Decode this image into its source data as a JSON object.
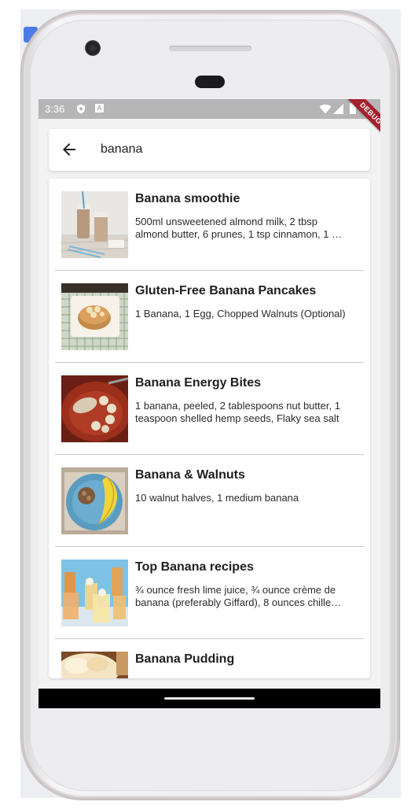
{
  "status_bar": {
    "time": "3:36",
    "shield_icon": "shield-icon",
    "notification_icon": "a-notification-icon",
    "wifi_icon": "wifi-icon",
    "signal_icon": "signal-icon",
    "battery_icon": "battery-icon"
  },
  "debug_banner": {
    "label": "DEBUG",
    "color": "#a3222d"
  },
  "search": {
    "back_icon": "arrow-back-icon",
    "query": "banana"
  },
  "results": [
    {
      "title": "Banana smoothie",
      "description": "500ml unsweetened almond milk, 2 tbsp almond butter, 6 prunes, 1 tsp cinnamon, 1 …",
      "image": "smoothie-bottles-photo"
    },
    {
      "title": "Gluten-Free Banana Pancakes",
      "description": "1 Banana, 1 Egg, Chopped Walnuts (Optional)",
      "image": "banana-pancakes-photo"
    },
    {
      "title": "Banana Energy Bites",
      "description": "1 banana, peeled, 2 tablespoons nut butter, 1 teaspoon shelled hemp seeds, Flaky sea salt",
      "image": "energy-bites-photo"
    },
    {
      "title": "Banana & Walnuts",
      "description": "10 walnut halves, 1 medium banana",
      "image": "banana-walnuts-plate-photo"
    },
    {
      "title": "Top Banana recipes",
      "description": "¾ ounce fresh lime juice, ¾ ounce crème de banana (preferably Giffard), 8 ounces chille…",
      "image": "cocktail-glasses-photo"
    },
    {
      "title": "Banana Pudding",
      "description": "",
      "image": "banana-pudding-photo"
    }
  ],
  "colors": {
    "accent": "#1565c0",
    "status_bar": "#b5b5b5",
    "screen_background": "#f2f2f2"
  }
}
